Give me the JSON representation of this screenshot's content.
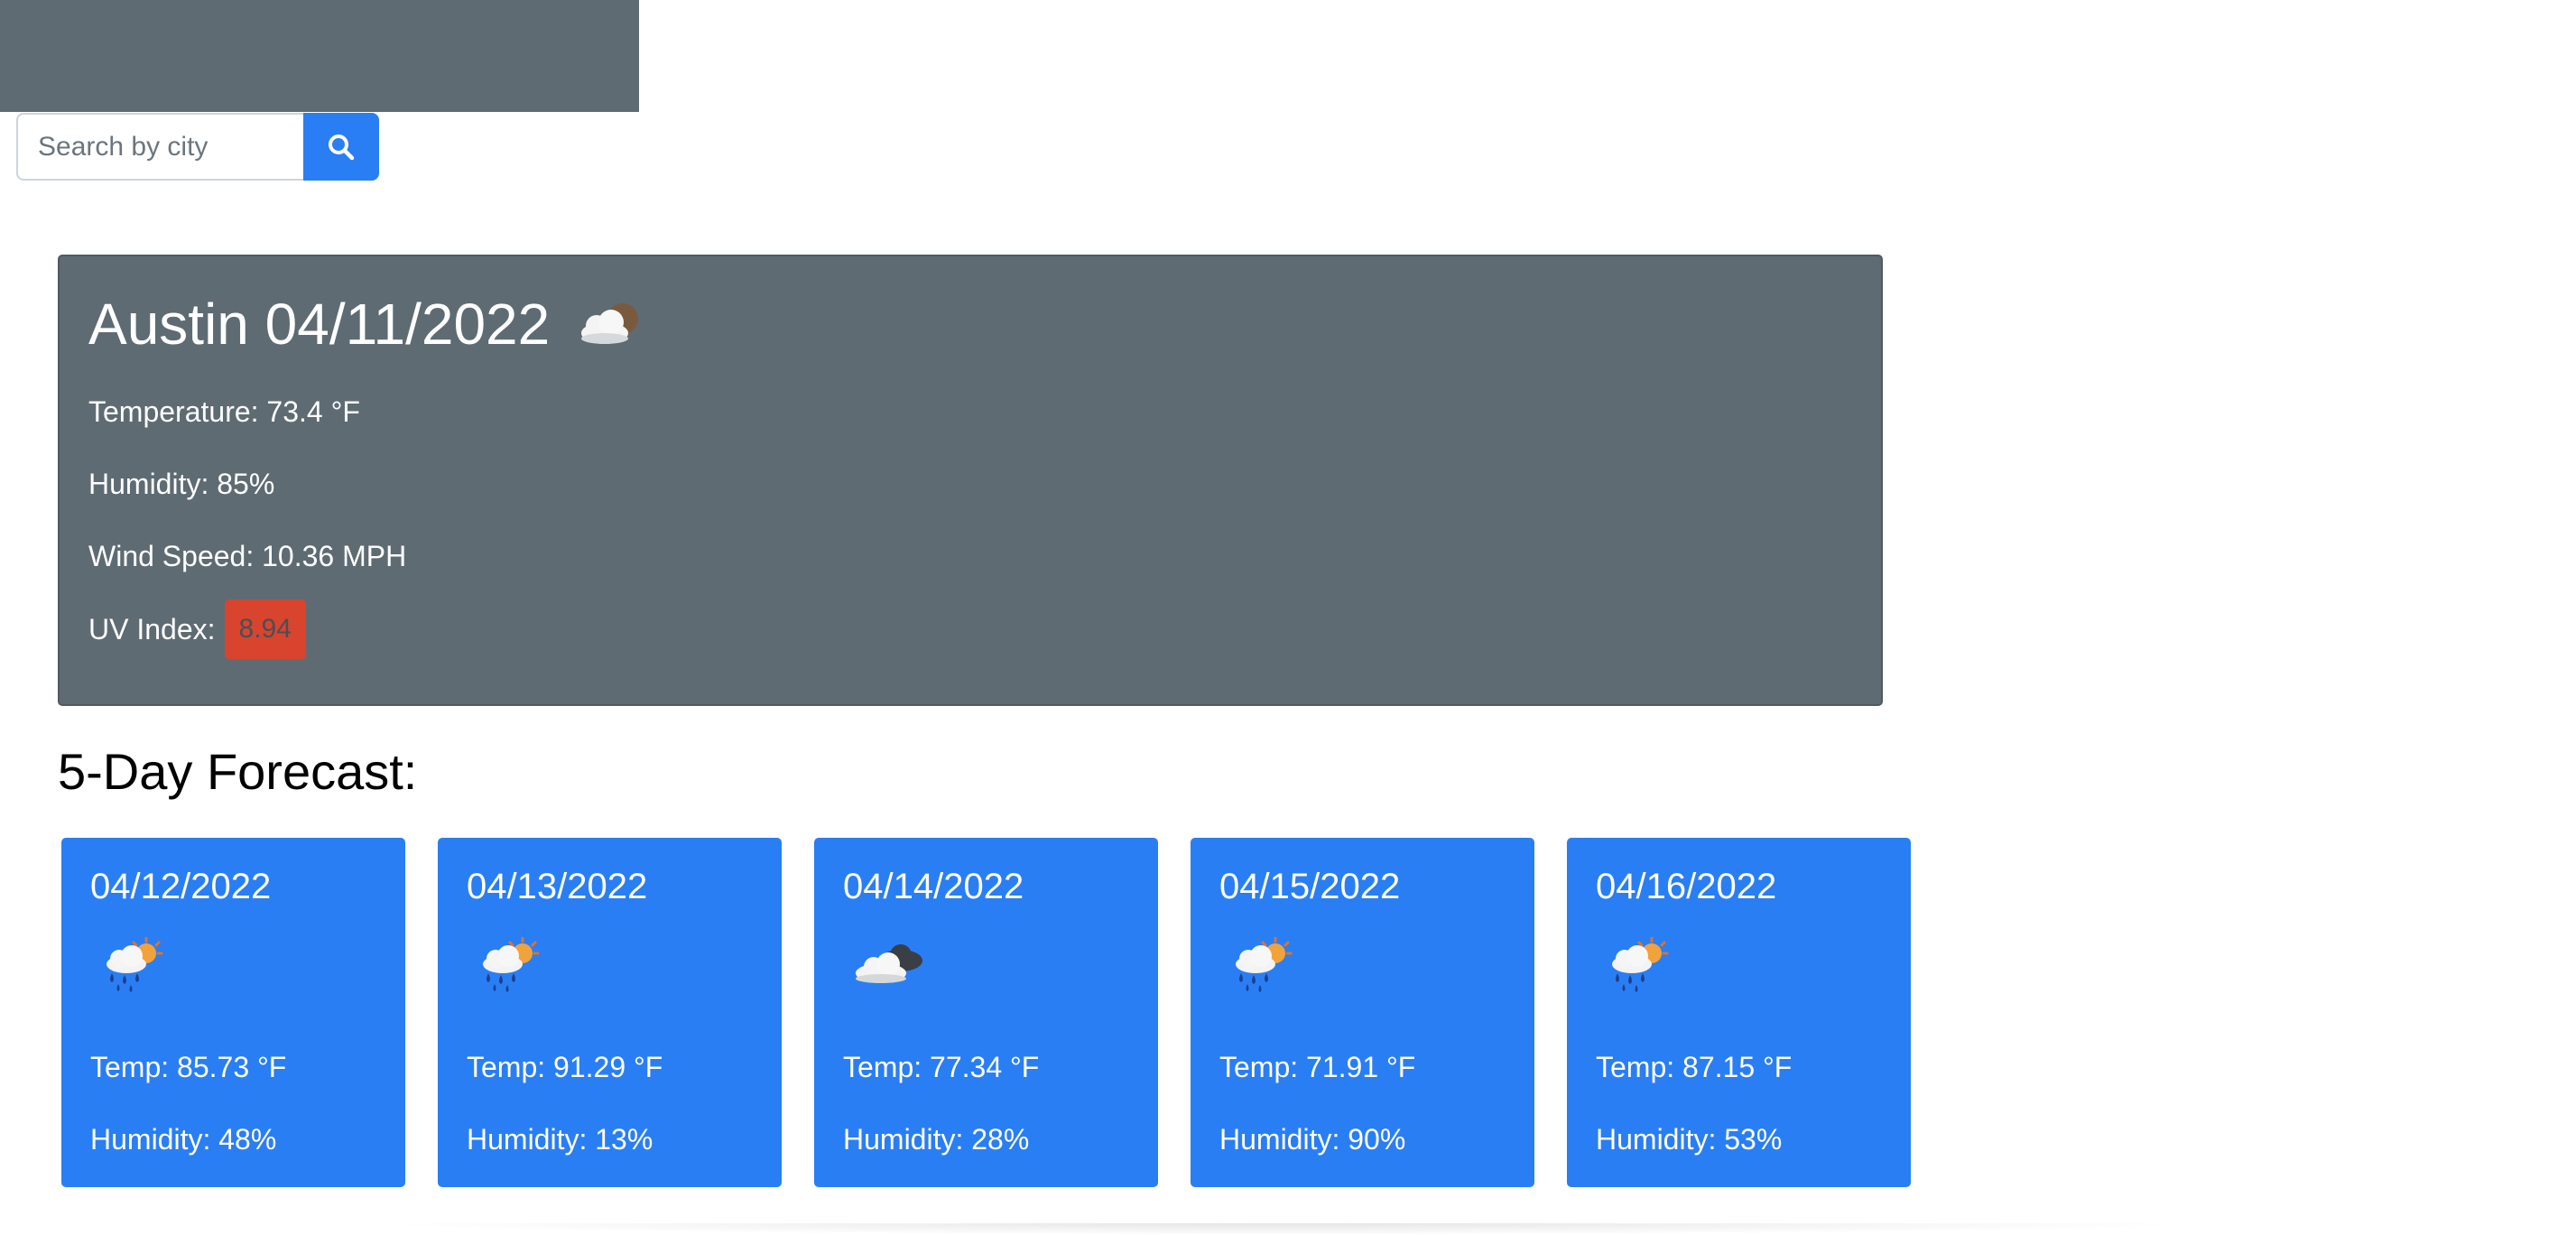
{
  "search": {
    "placeholder": "Search by city",
    "button_icon": "search-icon"
  },
  "current": {
    "city": "Austin",
    "date": "04/11/2022",
    "weather_icon": "partly-cloudy-icon",
    "temperature": "Temperature: 73.4 °F",
    "humidity": "Humidity: 85%",
    "wind": "Wind Speed: 10.36 MPH",
    "uv_label": "UV Index:",
    "uv_value": "8.94",
    "uv_color": "#d9442e"
  },
  "forecast": {
    "title": "5-Day Forecast:",
    "days": [
      {
        "date": "04/12/2022",
        "icon": "rain-sun-icon",
        "temp": "Temp: 85.73 °F",
        "humidity": "Humidity: 48%"
      },
      {
        "date": "04/13/2022",
        "icon": "rain-sun-icon",
        "temp": "Temp: 91.29 °F",
        "humidity": "Humidity: 13%"
      },
      {
        "date": "04/14/2022",
        "icon": "cloudy-icon",
        "temp": "Temp: 77.34 °F",
        "humidity": "Humidity: 28%"
      },
      {
        "date": "04/15/2022",
        "icon": "rain-sun-icon",
        "temp": "Temp: 71.91 °F",
        "humidity": "Humidity: 90%"
      },
      {
        "date": "04/16/2022",
        "icon": "rain-sun-icon",
        "temp": "Temp: 87.15 °F",
        "humidity": "Humidity: 53%"
      }
    ]
  },
  "colors": {
    "card_gray": "#5f6b73",
    "accent_blue": "#2a7ef3"
  }
}
